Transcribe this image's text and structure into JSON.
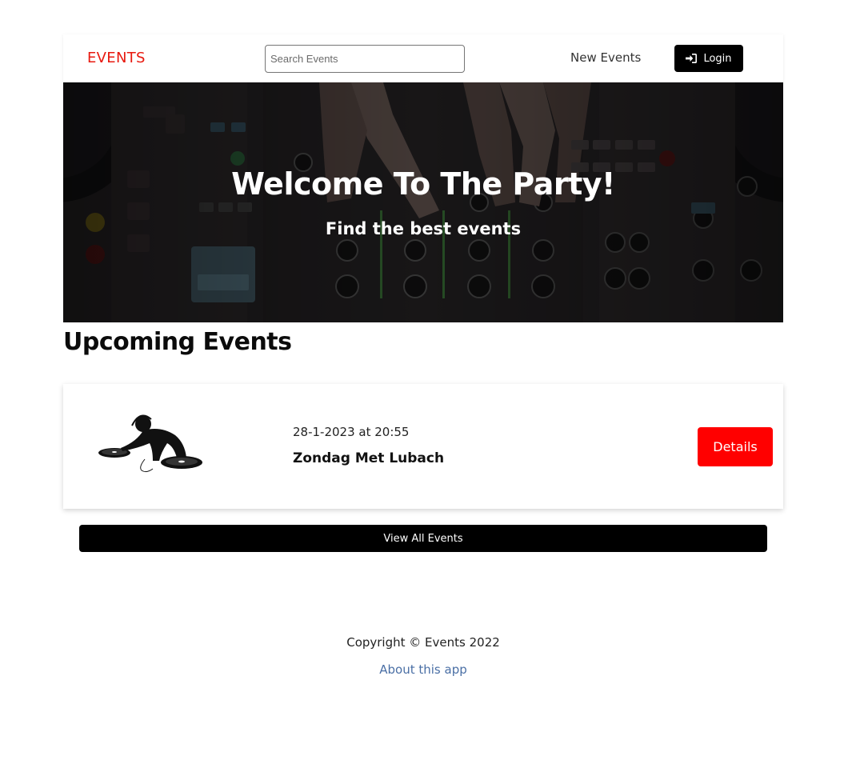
{
  "navbar": {
    "brand": "EVENTS",
    "search_placeholder": "Search Events",
    "search_value": "",
    "new_events_label": "New Events",
    "login_label": "Login"
  },
  "hero": {
    "title": "Welcome To The Party!",
    "subtitle": "Find the best events"
  },
  "upcoming": {
    "title": "Upcoming Events",
    "events": [
      {
        "date": "28-1-2023 at 20:55",
        "name": "Zondag Met Lubach",
        "details_label": "Details"
      }
    ],
    "view_all_label": "View All Events"
  },
  "footer": {
    "copyright": "Copyright © Events 2022",
    "about_link": "About this app"
  },
  "colors": {
    "brand": "#e8190f",
    "details_button": "#ff0000",
    "primary_dark": "#000000",
    "link": "#4a6fa5"
  },
  "icons": {
    "login": "sign-in-icon"
  }
}
